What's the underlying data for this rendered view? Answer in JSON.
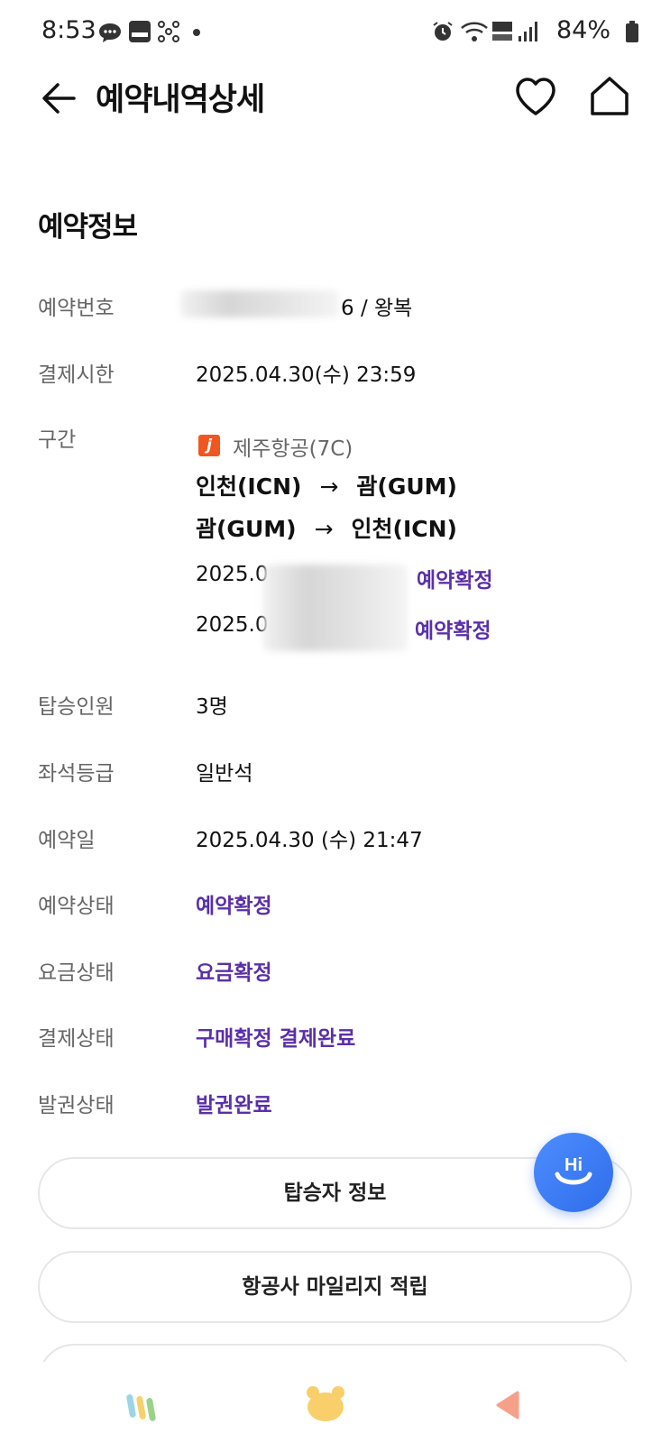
{
  "status_bar": {
    "time": "8:53",
    "battery": "84%",
    "icons": [
      "chat-icon",
      "m-global-icon",
      "network-icon",
      "dot-icon",
      "alarm-icon",
      "wifi-icon",
      "hd-voice-icon",
      "signal-icon",
      "battery-icon"
    ]
  },
  "header": {
    "title": "예약내역상세",
    "icons": [
      "back-arrow-icon",
      "heart-icon",
      "home-icon"
    ]
  },
  "section": {
    "title": "예약정보"
  },
  "info": {
    "booking_no": {
      "label": "예약번호",
      "value": "6 / 왕복"
    },
    "payment_deadline": {
      "label": "결제시한",
      "value": "2025.04.30(수) 23:59"
    },
    "segment": {
      "label": "구간",
      "airline_logo": "j",
      "airline": "제주항공(7C)",
      "routes": [
        {
          "from": "인천(ICN)",
          "arrow": "→",
          "to": "괌(GUM)"
        },
        {
          "from": "괌(GUM)",
          "arrow": "→",
          "to": "인천(ICN)"
        }
      ],
      "flights": [
        {
          "date": "2025.0",
          "status": "예약확정"
        },
        {
          "date": "2025.0",
          "status": "예약확정"
        }
      ]
    },
    "passengers": {
      "label": "탑승인원",
      "value": "3명"
    },
    "seat_class": {
      "label": "좌석등급",
      "value": "일반석"
    },
    "booking_date": {
      "label": "예약일",
      "value": "2025.04.30 (수) 21:47"
    },
    "booking_status": {
      "label": "예약상태",
      "value": "예약확정"
    },
    "fare_status": {
      "label": "요금상태",
      "value": "요금확정"
    },
    "payment_status": {
      "label": "결제상태",
      "value": "구매확정 결제완료"
    },
    "ticket_status": {
      "label": "발권상태",
      "value": "발권완료"
    }
  },
  "buttons": {
    "passenger_info": "탑승자 정보",
    "mileage": "항공사 마일리지 적립"
  },
  "fab": {
    "label": "Hi"
  },
  "colors": {
    "accent_purple": "#5b2fa8",
    "fab_blue": "#2f6dea",
    "airline_orange": "#f0561f"
  }
}
